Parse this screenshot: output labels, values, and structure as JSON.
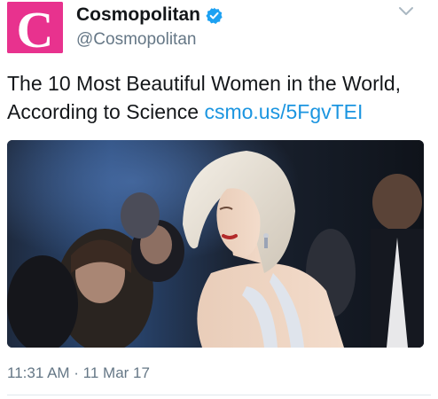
{
  "account": {
    "avatar_letter": "C",
    "avatar_color": "#e8328e",
    "name": "Cosmopolitan",
    "handle": "@Cosmopolitan",
    "verified": true
  },
  "tweet": {
    "text": "The 10 Most Beautiful Women in the World, According to Science",
    "link": "csmo.us/5FgvTEI",
    "timestamp": "11:31 AM · 11 Mar 17"
  },
  "icons": {
    "verified": "verified-badge-icon",
    "more": "chevron-down-icon"
  },
  "colors": {
    "text": "#14171a",
    "secondary": "#657786",
    "link": "#1b95e0",
    "verified": "#1da1f2"
  }
}
